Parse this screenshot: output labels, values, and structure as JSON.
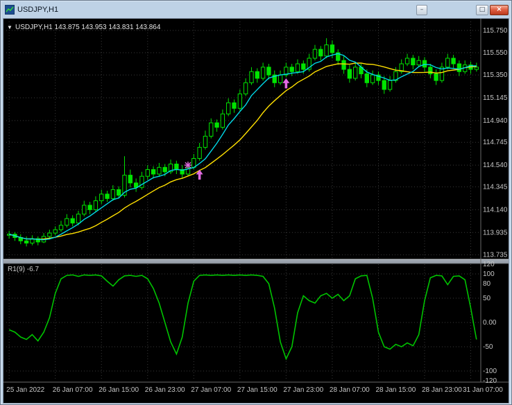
{
  "window": {
    "title": "USDJPY,H1",
    "controls": {
      "minimize_glyph": "–",
      "restore_glyph": "□",
      "close_glyph": "×"
    }
  },
  "chart": {
    "info_arrow": "▼",
    "info_label": "USDJPY,H1 143.875 143.953 143.831 143.864",
    "price_axis": [
      "115.750",
      "115.550",
      "115.350",
      "115.145",
      "114.940",
      "114.745",
      "114.540",
      "114.345",
      "114.140",
      "113.935",
      "113.735"
    ],
    "time_axis": [
      "25 Jan 2022",
      "26 Jan 07:00",
      "26 Jan 15:00",
      "26 Jan 23:00",
      "27 Jan 07:00",
      "27 Jan 15:00",
      "27 Jan 23:00",
      "28 Jan 07:00",
      "28 Jan 15:00",
      "28 Jan 23:00",
      "31 Jan 07:00"
    ],
    "indicator": {
      "label": "R1(9) -6.7",
      "axis": [
        "120",
        "100",
        "80",
        "50",
        "0.00",
        "-50",
        "-100",
        "-120"
      ]
    },
    "colors": {
      "background": "#000000",
      "grid": "#3a3a3a",
      "candle": "#00e400",
      "ma_fast": "#00d9e8",
      "ma_slow": "#ffe000",
      "oscillator": "#00c400",
      "marker": "#e06ae0",
      "axis_text": "#c6c6c6",
      "frame": "#6a6a6a",
      "splitter": "#9aa2ac"
    }
  },
  "chart_data": {
    "type": "candlestick",
    "symbol": "USDJPY",
    "timeframe": "H1",
    "price_range": [
      113.7,
      115.83
    ],
    "gridline_bars": [
      0,
      8,
      16,
      24,
      32,
      40,
      48,
      56,
      64,
      72,
      80
    ],
    "ohlc": [
      [
        113.91,
        113.95,
        113.88,
        113.92
      ],
      [
        113.92,
        113.94,
        113.86,
        113.89
      ],
      [
        113.89,
        113.92,
        113.83,
        113.86
      ],
      [
        113.86,
        113.9,
        113.81,
        113.84
      ],
      [
        113.84,
        113.91,
        113.82,
        113.88
      ],
      [
        113.88,
        113.9,
        113.82,
        113.85
      ],
      [
        113.85,
        113.93,
        113.84,
        113.9
      ],
      [
        113.9,
        113.96,
        113.88,
        113.93
      ],
      [
        113.93,
        113.99,
        113.91,
        113.96
      ],
      [
        113.96,
        114.04,
        113.94,
        114.0
      ],
      [
        114.0,
        114.1,
        113.98,
        114.06
      ],
      [
        114.06,
        114.09,
        113.99,
        114.02
      ],
      [
        114.02,
        114.13,
        114.0,
        114.1
      ],
      [
        114.1,
        114.22,
        114.08,
        114.18
      ],
      [
        114.18,
        114.21,
        114.1,
        114.14
      ],
      [
        114.14,
        114.26,
        114.12,
        114.22
      ],
      [
        114.22,
        114.32,
        114.19,
        114.28
      ],
      [
        114.28,
        114.31,
        114.21,
        114.24
      ],
      [
        114.24,
        114.36,
        114.22,
        114.32
      ],
      [
        114.32,
        114.35,
        114.24,
        114.27
      ],
      [
        114.27,
        114.62,
        114.25,
        114.45
      ],
      [
        114.45,
        114.5,
        114.34,
        114.38
      ],
      [
        114.38,
        114.42,
        114.3,
        114.34
      ],
      [
        114.34,
        114.48,
        114.32,
        114.44
      ],
      [
        114.44,
        114.54,
        114.41,
        114.5
      ],
      [
        114.5,
        114.53,
        114.42,
        114.46
      ],
      [
        114.46,
        114.56,
        114.44,
        114.52
      ],
      [
        114.52,
        114.55,
        114.44,
        114.48
      ],
      [
        114.48,
        114.59,
        114.46,
        114.55
      ],
      [
        114.55,
        114.58,
        114.46,
        114.5
      ],
      [
        114.5,
        114.54,
        114.42,
        114.46
      ],
      [
        114.46,
        114.56,
        114.44,
        114.52
      ],
      [
        114.52,
        114.64,
        114.5,
        114.6
      ],
      [
        114.6,
        114.74,
        114.58,
        114.7
      ],
      [
        114.7,
        114.85,
        114.68,
        114.8
      ],
      [
        114.8,
        114.96,
        114.78,
        114.92
      ],
      [
        114.92,
        114.95,
        114.84,
        114.88
      ],
      [
        114.88,
        115.04,
        114.86,
        115.0
      ],
      [
        115.0,
        115.14,
        114.98,
        115.1
      ],
      [
        115.1,
        115.13,
        115.01,
        115.05
      ],
      [
        115.05,
        115.22,
        115.03,
        115.18
      ],
      [
        115.18,
        115.32,
        115.16,
        115.28
      ],
      [
        115.28,
        115.42,
        115.26,
        115.38
      ],
      [
        115.38,
        115.41,
        115.28,
        115.32
      ],
      [
        115.32,
        115.46,
        115.3,
        115.42
      ],
      [
        115.42,
        115.45,
        115.31,
        115.35
      ],
      [
        115.35,
        115.39,
        115.24,
        115.28
      ],
      [
        115.28,
        115.39,
        115.26,
        115.35
      ],
      [
        115.35,
        115.46,
        115.33,
        115.42
      ],
      [
        115.42,
        115.45,
        115.34,
        115.38
      ],
      [
        115.38,
        115.49,
        115.36,
        115.45
      ],
      [
        115.45,
        115.48,
        115.36,
        115.4
      ],
      [
        115.4,
        115.54,
        115.38,
        115.5
      ],
      [
        115.5,
        115.62,
        115.48,
        115.58
      ],
      [
        115.58,
        115.61,
        115.48,
        115.52
      ],
      [
        115.52,
        115.68,
        115.5,
        115.62
      ],
      [
        115.62,
        115.66,
        115.5,
        115.55
      ],
      [
        115.55,
        115.58,
        115.44,
        115.48
      ],
      [
        115.48,
        115.52,
        115.36,
        115.4
      ],
      [
        115.4,
        115.44,
        115.28,
        115.32
      ],
      [
        115.32,
        115.46,
        115.3,
        115.42
      ],
      [
        115.42,
        115.45,
        115.32,
        115.36
      ],
      [
        115.36,
        115.4,
        115.24,
        115.28
      ],
      [
        115.28,
        115.39,
        115.26,
        115.35
      ],
      [
        115.35,
        115.38,
        115.26,
        115.3
      ],
      [
        115.3,
        115.34,
        115.18,
        115.22
      ],
      [
        115.22,
        115.34,
        115.2,
        115.3
      ],
      [
        115.3,
        115.42,
        115.28,
        115.38
      ],
      [
        115.38,
        115.49,
        115.36,
        115.45
      ],
      [
        115.45,
        115.54,
        115.43,
        115.5
      ],
      [
        115.5,
        115.53,
        115.4,
        115.44
      ],
      [
        115.44,
        115.52,
        115.42,
        115.48
      ],
      [
        115.48,
        115.51,
        115.38,
        115.42
      ],
      [
        115.42,
        115.45,
        115.32,
        115.36
      ],
      [
        115.36,
        115.4,
        115.26,
        115.3
      ],
      [
        115.3,
        115.46,
        115.28,
        115.42
      ],
      [
        115.42,
        115.54,
        115.4,
        115.5
      ],
      [
        115.5,
        115.53,
        115.41,
        115.45
      ],
      [
        115.45,
        115.48,
        115.34,
        115.38
      ],
      [
        115.38,
        115.48,
        115.36,
        115.44
      ],
      [
        115.44,
        115.47,
        115.36,
        115.4
      ],
      [
        115.4,
        115.46,
        115.38,
        115.42
      ]
    ],
    "ma_fast": {
      "period": 6
    },
    "ma_slow": {
      "period": 14
    },
    "oscillator": {
      "name": "R1(9)",
      "current_value": -6.7,
      "range": [
        -120,
        120
      ],
      "grid_levels": [
        100,
        50,
        0,
        -50,
        -100
      ],
      "values": [
        -15,
        -20,
        -30,
        -35,
        -25,
        -38,
        -20,
        10,
        60,
        90,
        97,
        98,
        95,
        98,
        97,
        98,
        96,
        85,
        75,
        88,
        96,
        97,
        95,
        97,
        90,
        70,
        40,
        0,
        -40,
        -65,
        -30,
        40,
        85,
        97,
        98,
        97,
        98,
        97,
        98,
        97,
        98,
        97,
        98,
        97,
        95,
        80,
        30,
        -40,
        -75,
        -50,
        20,
        55,
        45,
        40,
        55,
        60,
        50,
        58,
        45,
        55,
        90,
        96,
        97,
        50,
        -20,
        -50,
        -55,
        -45,
        -50,
        -42,
        -48,
        -25,
        45,
        92,
        97,
        96,
        78,
        95,
        96,
        88,
        30,
        -35
      ]
    },
    "markers": [
      {
        "type": "star",
        "bar": 31,
        "price": 114.54
      },
      {
        "type": "arrow-up",
        "bar": 33,
        "price": 114.5
      },
      {
        "type": "arrow-up",
        "bar": 48,
        "price": 115.32
      }
    ]
  }
}
